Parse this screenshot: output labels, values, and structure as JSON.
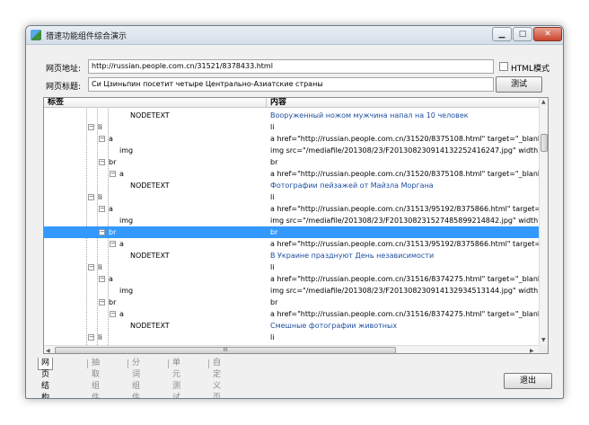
{
  "window": {
    "title": "猎速功能组件综合演示"
  },
  "form": {
    "url_label": "网页地址:",
    "url_value": "http://russian.people.com.cn/31521/8378433.html",
    "html_mode_label": "HTML模式",
    "title_label": "网页标题:",
    "title_value": "Си Цзиньпин посетит четыре Центрально-Азиатские страны",
    "test_button": "测试"
  },
  "tree": {
    "headers": [
      "标签",
      "内容"
    ],
    "rows": [
      {
        "indent": 8,
        "toggle": "",
        "tag": "NODETEXT",
        "content": "Вооруженный ножом мужчина напал на 10 человек",
        "link": true,
        "selected": false
      },
      {
        "indent": 5,
        "toggle": "−",
        "tag": "li",
        "content": "li",
        "link": false,
        "selected": false
      },
      {
        "indent": 6,
        "toggle": "−",
        "tag": "a",
        "content": "a href=\"http://russian.people.com.cn/31520/8375108.html\" target=\"_blank\"",
        "link": false,
        "selected": false
      },
      {
        "indent": 7,
        "toggle": "",
        "tag": "img",
        "content": "img src=\"/mediafile/201308/23/F201308230914132252416247.jpg\" width=\"120\" h",
        "link": false,
        "selected": false
      },
      {
        "indent": 6,
        "toggle": "−",
        "tag": "br",
        "content": "br",
        "link": false,
        "selected": false
      },
      {
        "indent": 7,
        "toggle": "−",
        "tag": "a",
        "content": "a href=\"http://russian.people.com.cn/31520/8375108.html\" target=\"_blank\"",
        "link": false,
        "selected": false
      },
      {
        "indent": 8,
        "toggle": "",
        "tag": "NODETEXT",
        "content": "Фотографии пейзажей от Майзла Моргана",
        "link": true,
        "selected": false
      },
      {
        "indent": 5,
        "toggle": "−",
        "tag": "li",
        "content": "li",
        "link": false,
        "selected": false
      },
      {
        "indent": 6,
        "toggle": "−",
        "tag": "a",
        "content": "a href=\"http://russian.people.com.cn/31513/95192/8375866.html\" target=\"_blank",
        "link": false,
        "selected": false
      },
      {
        "indent": 7,
        "toggle": "",
        "tag": "img",
        "content": "img src=\"/mediafile/201308/23/F201308231527485899214842.jpg\" width=\"120\" h",
        "link": false,
        "selected": false
      },
      {
        "indent": 6,
        "toggle": "−",
        "tag": "br",
        "content": "br",
        "link": false,
        "selected": true
      },
      {
        "indent": 7,
        "toggle": "−",
        "tag": "a",
        "content": "a href=\"http://russian.people.com.cn/31513/95192/8375866.html\" target=\"_blank",
        "link": false,
        "selected": false
      },
      {
        "indent": 8,
        "toggle": "",
        "tag": "NODETEXT",
        "content": "В Украине празднуют День независимости",
        "link": true,
        "selected": false
      },
      {
        "indent": 5,
        "toggle": "−",
        "tag": "li",
        "content": "li",
        "link": false,
        "selected": false
      },
      {
        "indent": 6,
        "toggle": "−",
        "tag": "a",
        "content": "a href=\"http://russian.people.com.cn/31516/8374275.html\" target=\"_blank\"",
        "link": false,
        "selected": false
      },
      {
        "indent": 7,
        "toggle": "",
        "tag": "img",
        "content": "img src=\"/mediafile/201308/23/F201308230914132934513144.jpg\" width=\"120\" h",
        "link": false,
        "selected": false
      },
      {
        "indent": 6,
        "toggle": "−",
        "tag": "br",
        "content": "br",
        "link": false,
        "selected": false
      },
      {
        "indent": 7,
        "toggle": "−",
        "tag": "a",
        "content": "a href=\"http://russian.people.com.cn/31516/8374275.html\" target=\"_blank\"",
        "link": false,
        "selected": false
      },
      {
        "indent": 8,
        "toggle": "",
        "tag": "NODETEXT",
        "content": "Смешные фотографии животных",
        "link": true,
        "selected": false
      },
      {
        "indent": 5,
        "toggle": "−",
        "tag": "li",
        "content": "li",
        "link": false,
        "selected": false
      }
    ]
  },
  "tabs": [
    {
      "label": "网页结构树",
      "active": true
    },
    {
      "label": "抽取组件",
      "active": false
    },
    {
      "label": "分词组件",
      "active": false
    },
    {
      "label": "单元测试",
      "active": false
    },
    {
      "label": "自定义页面",
      "active": false
    }
  ],
  "exit_button": "退出",
  "scroll_grip": "III",
  "colors": {
    "selection": "#3399ff",
    "link_text": "#1f4fa0"
  }
}
